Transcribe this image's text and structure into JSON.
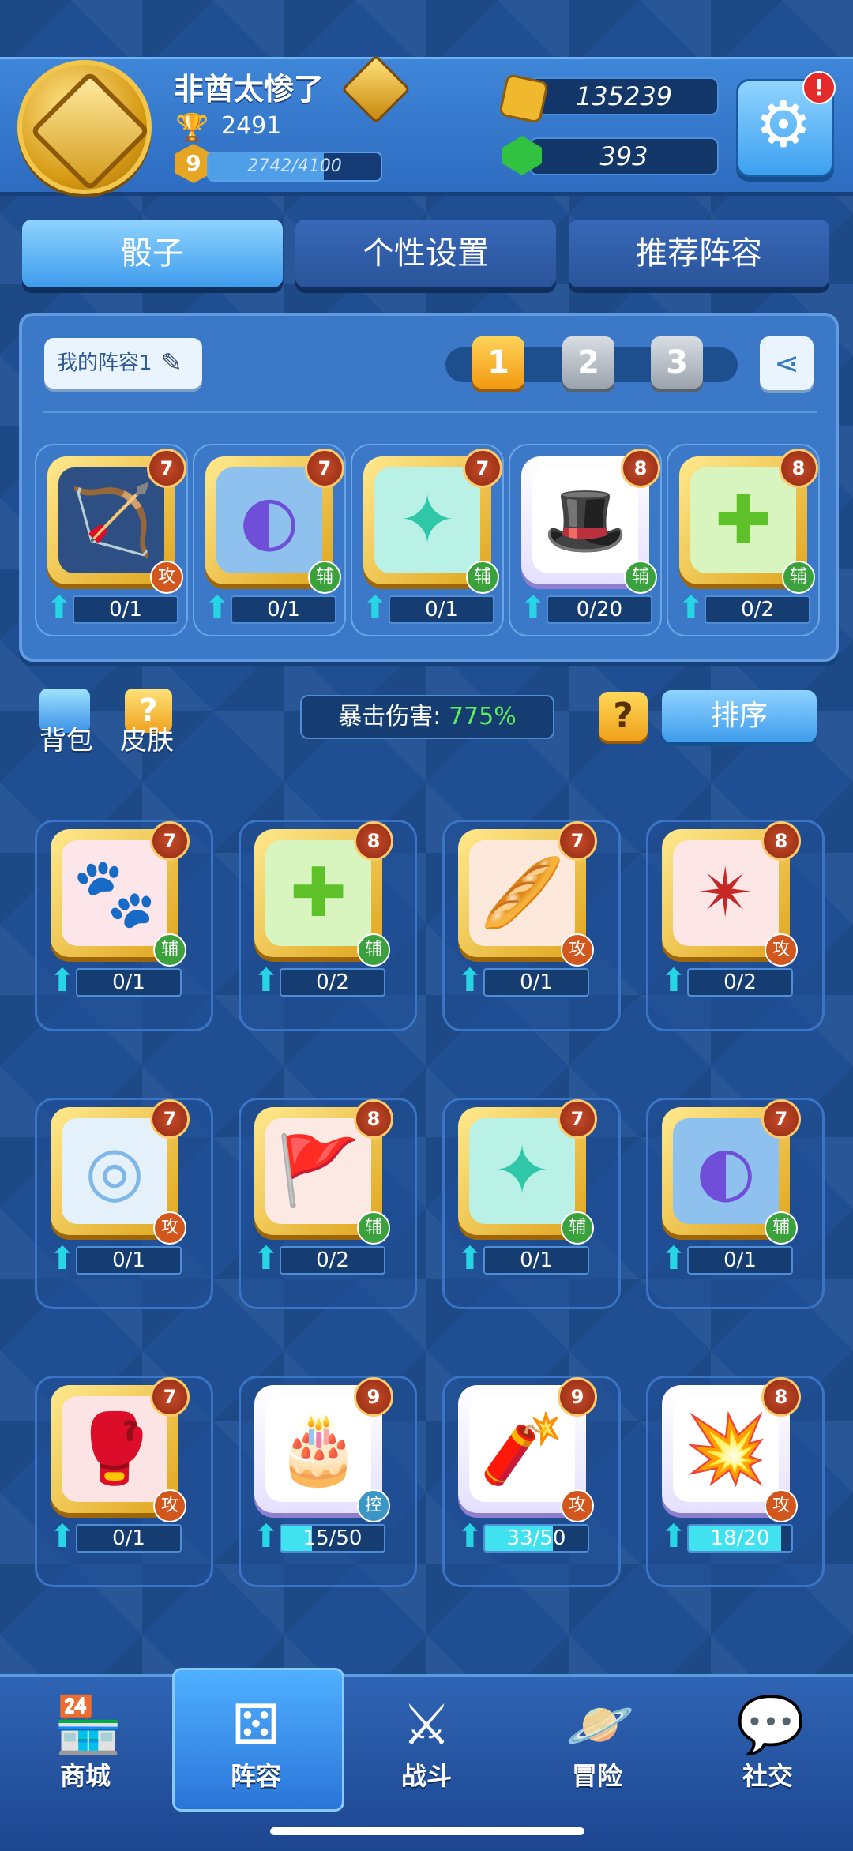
{
  "player": {
    "name": "非酋太惨了",
    "trophies": "2491",
    "level": "9",
    "xp": "2742/4100",
    "xp_fraction": 0.669
  },
  "resources": {
    "gold": "135239",
    "gems": "393"
  },
  "alert_badge": "!",
  "tabs": [
    "骰子",
    "个性设置",
    "推荐阵容"
  ],
  "lineup": {
    "name": "我的阵容1",
    "slots": [
      "1",
      "2",
      "3"
    ],
    "selected_slot": "1"
  },
  "lineup_dice": [
    {
      "level": "7",
      "role": "攻",
      "progress": "0/1",
      "fill": 0,
      "icon": "crossbow-icon",
      "color": "#2d4f84"
    },
    {
      "level": "7",
      "role": "辅",
      "progress": "0/1",
      "fill": 0,
      "icon": "mask-icon",
      "color": "#8fc1ef"
    },
    {
      "level": "7",
      "role": "辅",
      "progress": "0/1",
      "fill": 0,
      "icon": "wind-swirl-icon",
      "color": "#b9f1e6"
    },
    {
      "level": "8",
      "role": "辅",
      "progress": "0/20",
      "fill": 0,
      "icon": "magic-hat-icon",
      "color": "#ffffff",
      "plain": true
    },
    {
      "level": "8",
      "role": "辅",
      "progress": "0/2",
      "fill": 0,
      "icon": "heal-cross-icon",
      "color": "#d8f5c0"
    }
  ],
  "toolbar": {
    "backpack": "背包",
    "skin": "皮肤",
    "crit_label": "暴击伤害:",
    "crit_value": "775%",
    "help": "?",
    "sort": "排序"
  },
  "collection": [
    {
      "level": "7",
      "role": "辅",
      "progress": "0/1",
      "fill": 0,
      "icon": "paw-icon",
      "color": "#fde6ea"
    },
    {
      "level": "8",
      "role": "辅",
      "progress": "0/2",
      "fill": 0,
      "icon": "heal-cross-icon",
      "color": "#d8f5c0"
    },
    {
      "level": "7",
      "role": "攻",
      "progress": "0/1",
      "fill": 0,
      "icon": "bread-icon",
      "color": "#fde9dc"
    },
    {
      "level": "8",
      "role": "攻",
      "progress": "0/2",
      "fill": 0,
      "icon": "shuriken-icon",
      "color": "#fde6e6"
    },
    {
      "level": "7",
      "role": "攻",
      "progress": "0/1",
      "fill": 0,
      "icon": "sun-ring-icon",
      "color": "#e4f1fb"
    },
    {
      "level": "8",
      "role": "辅",
      "progress": "0/2",
      "fill": 0,
      "icon": "flags-icon",
      "color": "#fde9e4"
    },
    {
      "level": "7",
      "role": "辅",
      "progress": "0/1",
      "fill": 0,
      "icon": "wind-swirl-icon",
      "color": "#b9f1e6"
    },
    {
      "level": "7",
      "role": "辅",
      "progress": "0/1",
      "fill": 0,
      "icon": "mask-icon",
      "color": "#8fc1ef"
    },
    {
      "level": "7",
      "role": "攻",
      "progress": "0/1",
      "fill": 0,
      "icon": "boxing-glove-icon",
      "color": "#fde4e4"
    },
    {
      "level": "9",
      "role": "控",
      "progress": "15/50",
      "fill": 0.3,
      "icon": "cake-icon",
      "color": "#ffffff",
      "plain": true
    },
    {
      "level": "9",
      "role": "攻",
      "progress": "33/50",
      "fill": 0.66,
      "icon": "firecracker-icon",
      "color": "#ffffff",
      "plain": true
    },
    {
      "level": "8",
      "role": "攻",
      "progress": "18/20",
      "fill": 0.9,
      "icon": "explosion-icon",
      "color": "#ffffff",
      "plain": true
    }
  ],
  "nav": [
    "商城",
    "阵容",
    "战斗",
    "冒险",
    "社交"
  ],
  "colors": {
    "accent": "#3e9cec",
    "gold": "#f0b82c",
    "attack": "#d1571e",
    "support": "#3ba13c",
    "control": "#3b96c5"
  }
}
